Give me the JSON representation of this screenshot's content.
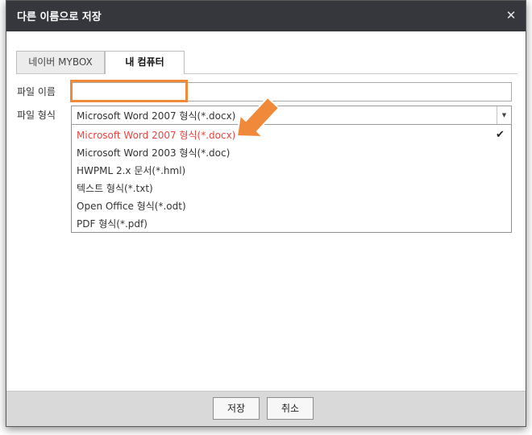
{
  "dialog": {
    "title": "다른 이름으로 저장",
    "close_icon": "close-icon"
  },
  "tabs": [
    {
      "label": "네이버 MYBOX",
      "active": false
    },
    {
      "label": "내 컴퓨터",
      "active": true
    }
  ],
  "form": {
    "file_name_label": "파일 이름",
    "file_name_value": "",
    "file_format_label": "파일 형식",
    "file_format_selected": "Microsoft Word 2007 형식(*.docx)"
  },
  "format_options": [
    {
      "label": "Microsoft Word 2007 형식(*.docx)",
      "selected": true
    },
    {
      "label": "Microsoft Word 2003 형식(*.doc)",
      "selected": false
    },
    {
      "label": "HWPML 2.x 문서(*.hml)",
      "selected": false
    },
    {
      "label": "텍스트 형식(*.txt)",
      "selected": false
    },
    {
      "label": "Open Office 형식(*.odt)",
      "selected": false
    },
    {
      "label": "PDF 형식(*.pdf)",
      "selected": false
    }
  ],
  "buttons": {
    "save": "저장",
    "cancel": "취소"
  },
  "colors": {
    "titlebar": "#36373d",
    "selected_option": "#e8463f",
    "annotation_orange": "#f08a3a"
  },
  "icons": {
    "close": "close-icon",
    "dropdown_arrow": "caret-down-icon",
    "selected_check": "checkmark-icon",
    "annotation_pointer": "arrow-pointer-icon"
  }
}
